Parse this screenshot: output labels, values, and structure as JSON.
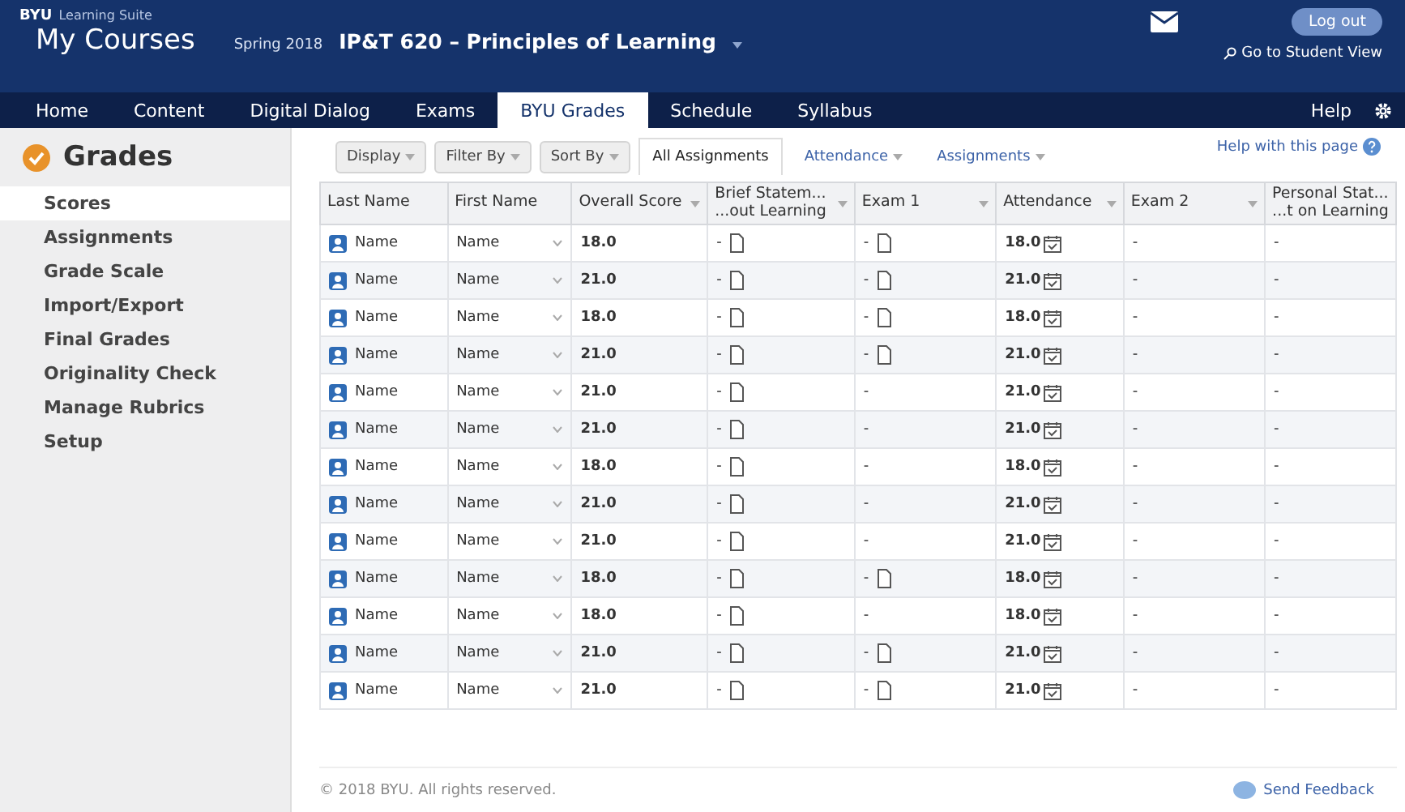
{
  "header": {
    "brand": "BYU",
    "suite": "Learning Suite",
    "title": "My Courses",
    "term": "Spring 2018",
    "course": "IP&T 620 – Principles of Learning",
    "logout": "Log out",
    "student_view": "Go to Student View"
  },
  "nav": {
    "tabs": [
      {
        "label": "Home",
        "selected": false
      },
      {
        "label": "Content",
        "selected": false
      },
      {
        "label": "Digital Dialog",
        "selected": false
      },
      {
        "label": "Exams",
        "selected": false
      },
      {
        "label": "BYU Grades",
        "selected": true
      },
      {
        "label": "Schedule",
        "selected": false
      },
      {
        "label": "Syllabus",
        "selected": false
      }
    ],
    "help": "Help"
  },
  "sidebar": {
    "title": "Grades",
    "items": [
      {
        "label": "Scores",
        "selected": true
      },
      {
        "label": "Assignments",
        "selected": false
      },
      {
        "label": "Grade Scale",
        "selected": false
      },
      {
        "label": "Import/Export",
        "selected": false
      },
      {
        "label": "Final Grades",
        "selected": false
      },
      {
        "label": "Originality Check",
        "selected": false
      },
      {
        "label": "Manage Rubrics",
        "selected": false
      },
      {
        "label": "Setup",
        "selected": false
      }
    ]
  },
  "toolbar": {
    "buttons": [
      "Display",
      "Filter By",
      "Sort By"
    ],
    "views": [
      {
        "label": "All Assignments",
        "selected": true
      },
      {
        "label": "Attendance",
        "selected": false
      },
      {
        "label": "Assignments",
        "selected": false
      }
    ],
    "help": "Help with this page"
  },
  "table": {
    "columns": [
      {
        "label": "Last Name",
        "sort": false
      },
      {
        "label": "First Name",
        "sort": false
      },
      {
        "label": "Overall Score",
        "sort": true
      },
      {
        "label": "Brief Statem...\n...out Learning",
        "sort": true
      },
      {
        "label": "Exam 1",
        "sort": true
      },
      {
        "label": "Attendance",
        "sort": true
      },
      {
        "label": "Exam 2",
        "sort": true
      },
      {
        "label": "Personal Stat...\n...t on Learning",
        "sort": false
      }
    ],
    "rows": [
      {
        "last": "Name",
        "first": "Name",
        "score": "18.0",
        "brief": "-",
        "brief_file": true,
        "exam1": "-",
        "exam1_file": true,
        "attendance": "18.0",
        "exam2": "-",
        "personal": "-"
      },
      {
        "last": "Name",
        "first": "Name",
        "score": "21.0",
        "brief": "-",
        "brief_file": true,
        "exam1": "-",
        "exam1_file": true,
        "attendance": "21.0",
        "exam2": "-",
        "personal": "-"
      },
      {
        "last": "Name",
        "first": "Name",
        "score": "18.0",
        "brief": "-",
        "brief_file": true,
        "exam1": "-",
        "exam1_file": true,
        "attendance": "18.0",
        "exam2": "-",
        "personal": "-"
      },
      {
        "last": "Name",
        "first": "Name",
        "score": "21.0",
        "brief": "-",
        "brief_file": true,
        "exam1": "-",
        "exam1_file": true,
        "attendance": "21.0",
        "exam2": "-",
        "personal": "-"
      },
      {
        "last": "Name",
        "first": "Name",
        "score": "21.0",
        "brief": "-",
        "brief_file": true,
        "exam1": "-",
        "exam1_file": false,
        "attendance": "21.0",
        "exam2": "-",
        "personal": "-"
      },
      {
        "last": "Name",
        "first": "Name",
        "score": "21.0",
        "brief": "-",
        "brief_file": true,
        "exam1": "-",
        "exam1_file": false,
        "attendance": "21.0",
        "exam2": "-",
        "personal": "-"
      },
      {
        "last": "Name",
        "first": "Name",
        "score": "18.0",
        "brief": "-",
        "brief_file": true,
        "exam1": "-",
        "exam1_file": false,
        "attendance": "18.0",
        "exam2": "-",
        "personal": "-"
      },
      {
        "last": "Name",
        "first": "Name",
        "score": "21.0",
        "brief": "-",
        "brief_file": true,
        "exam1": "-",
        "exam1_file": false,
        "attendance": "21.0",
        "exam2": "-",
        "personal": "-"
      },
      {
        "last": "Name",
        "first": "Name",
        "score": "21.0",
        "brief": "-",
        "brief_file": true,
        "exam1": "-",
        "exam1_file": false,
        "attendance": "21.0",
        "exam2": "-",
        "personal": "-"
      },
      {
        "last": "Name",
        "first": "Name",
        "score": "18.0",
        "brief": "-",
        "brief_file": true,
        "exam1": "-",
        "exam1_file": true,
        "attendance": "18.0",
        "exam2": "-",
        "personal": "-"
      },
      {
        "last": "Name",
        "first": "Name",
        "score": "18.0",
        "brief": "-",
        "brief_file": true,
        "exam1": "-",
        "exam1_file": false,
        "attendance": "18.0",
        "exam2": "-",
        "personal": "-"
      },
      {
        "last": "Name",
        "first": "Name",
        "score": "21.0",
        "brief": "-",
        "brief_file": true,
        "exam1": "-",
        "exam1_file": true,
        "attendance": "21.0",
        "exam2": "-",
        "personal": "-"
      },
      {
        "last": "Name",
        "first": "Name",
        "score": "21.0",
        "brief": "-",
        "brief_file": true,
        "exam1": "-",
        "exam1_file": true,
        "attendance": "21.0",
        "exam2": "-",
        "personal": "-"
      }
    ]
  },
  "footer": {
    "copyright": "© 2018 BYU. All rights reserved.",
    "feedback": "Send Feedback"
  }
}
